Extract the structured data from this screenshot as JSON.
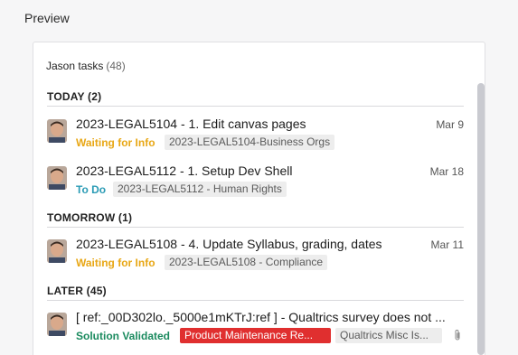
{
  "panel": {
    "title": "Preview"
  },
  "list": {
    "title": "Jason tasks",
    "count": "(48)"
  },
  "groups": [
    {
      "label": "TODAY (2)"
    },
    {
      "label": "TOMORROW (1)"
    },
    {
      "label": "LATER (45)"
    }
  ],
  "tasks": [
    {
      "title": "2023-LEGAL5104 - 1. Edit canvas pages",
      "date": "Mar 9",
      "status": "Waiting for Info",
      "status_color": "#e8a715",
      "tag": "2023-LEGAL5104-Business Orgs"
    },
    {
      "title": "2023-LEGAL5112 - 1. Setup Dev Shell",
      "date": "Mar 18",
      "status": "To Do",
      "status_color": "#2a9bb5",
      "tag": "2023-LEGAL5112 - Human Rights"
    },
    {
      "title": "2023-LEGAL5108 - 4. Update Syllabus, grading, dates",
      "date": "Mar 11",
      "status": "Waiting for Info",
      "status_color": "#e8a715",
      "tag": "2023-LEGAL5108 - Compliance"
    },
    {
      "title": "[ ref:_00D302lo._5000e1mKTrJ:ref ] - Qualtrics survey does not ...",
      "date": "",
      "status": "Solution Validated",
      "status_color": "#1a8a5e",
      "tag_red": "Product Maintenance Re...",
      "tag": "Qualtrics Misc Is..."
    }
  ],
  "icons": {
    "avatar": "user-avatar",
    "attachment": "paperclip-icon"
  }
}
